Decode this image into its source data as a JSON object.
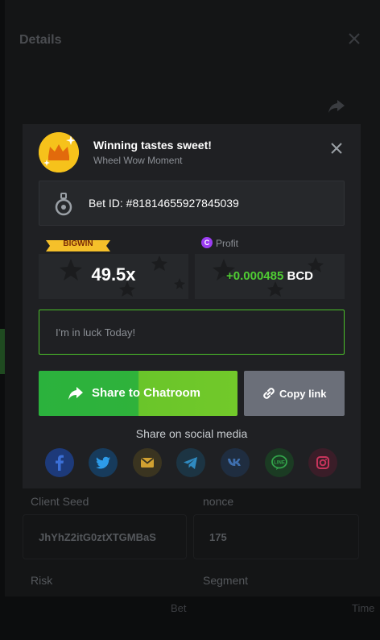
{
  "details": {
    "title": "Details",
    "client_seed_label": "Client Seed",
    "client_seed_value": "JhYhZ2itG0ztXTGMBaS",
    "nonce_label": "nonce",
    "nonce_value": "175",
    "risk_label": "Risk",
    "segment_label": "Segment",
    "footer_bet": "Bet",
    "footer_time": "Time"
  },
  "modal": {
    "title": "Winning tastes sweet!",
    "subtitle": "Wheel Wow Moment",
    "bet_id": "Bet ID: #81814655927845039",
    "badge": "BIGWIN",
    "multiplier": "49.5x",
    "profit_label": "Profit",
    "coin_glyph": "C",
    "profit_value": "+0.000485",
    "currency": "BCD",
    "message_placeholder": "I'm in luck Today!",
    "share_label": "Share to Chatroom",
    "copy_label": "Copy link",
    "social_title": "Share on social media",
    "social": [
      {
        "name": "facebook-icon",
        "color": "#1d3a7a",
        "fg": "#3b6fd6"
      },
      {
        "name": "twitter-icon",
        "color": "#173b5c",
        "fg": "#2d9be9"
      },
      {
        "name": "email-icon",
        "color": "#3a3420",
        "fg": "#d1a131"
      },
      {
        "name": "telegram-icon",
        "color": "#1c3443",
        "fg": "#2f8ac0"
      },
      {
        "name": "vk-icon",
        "color": "#1f2d40",
        "fg": "#3f6fae"
      },
      {
        "name": "line-icon",
        "color": "#1b3b23",
        "fg": "#32a34a"
      },
      {
        "name": "instagram-icon",
        "color": "#3a1d28",
        "fg": "#c7345b"
      }
    ]
  }
}
